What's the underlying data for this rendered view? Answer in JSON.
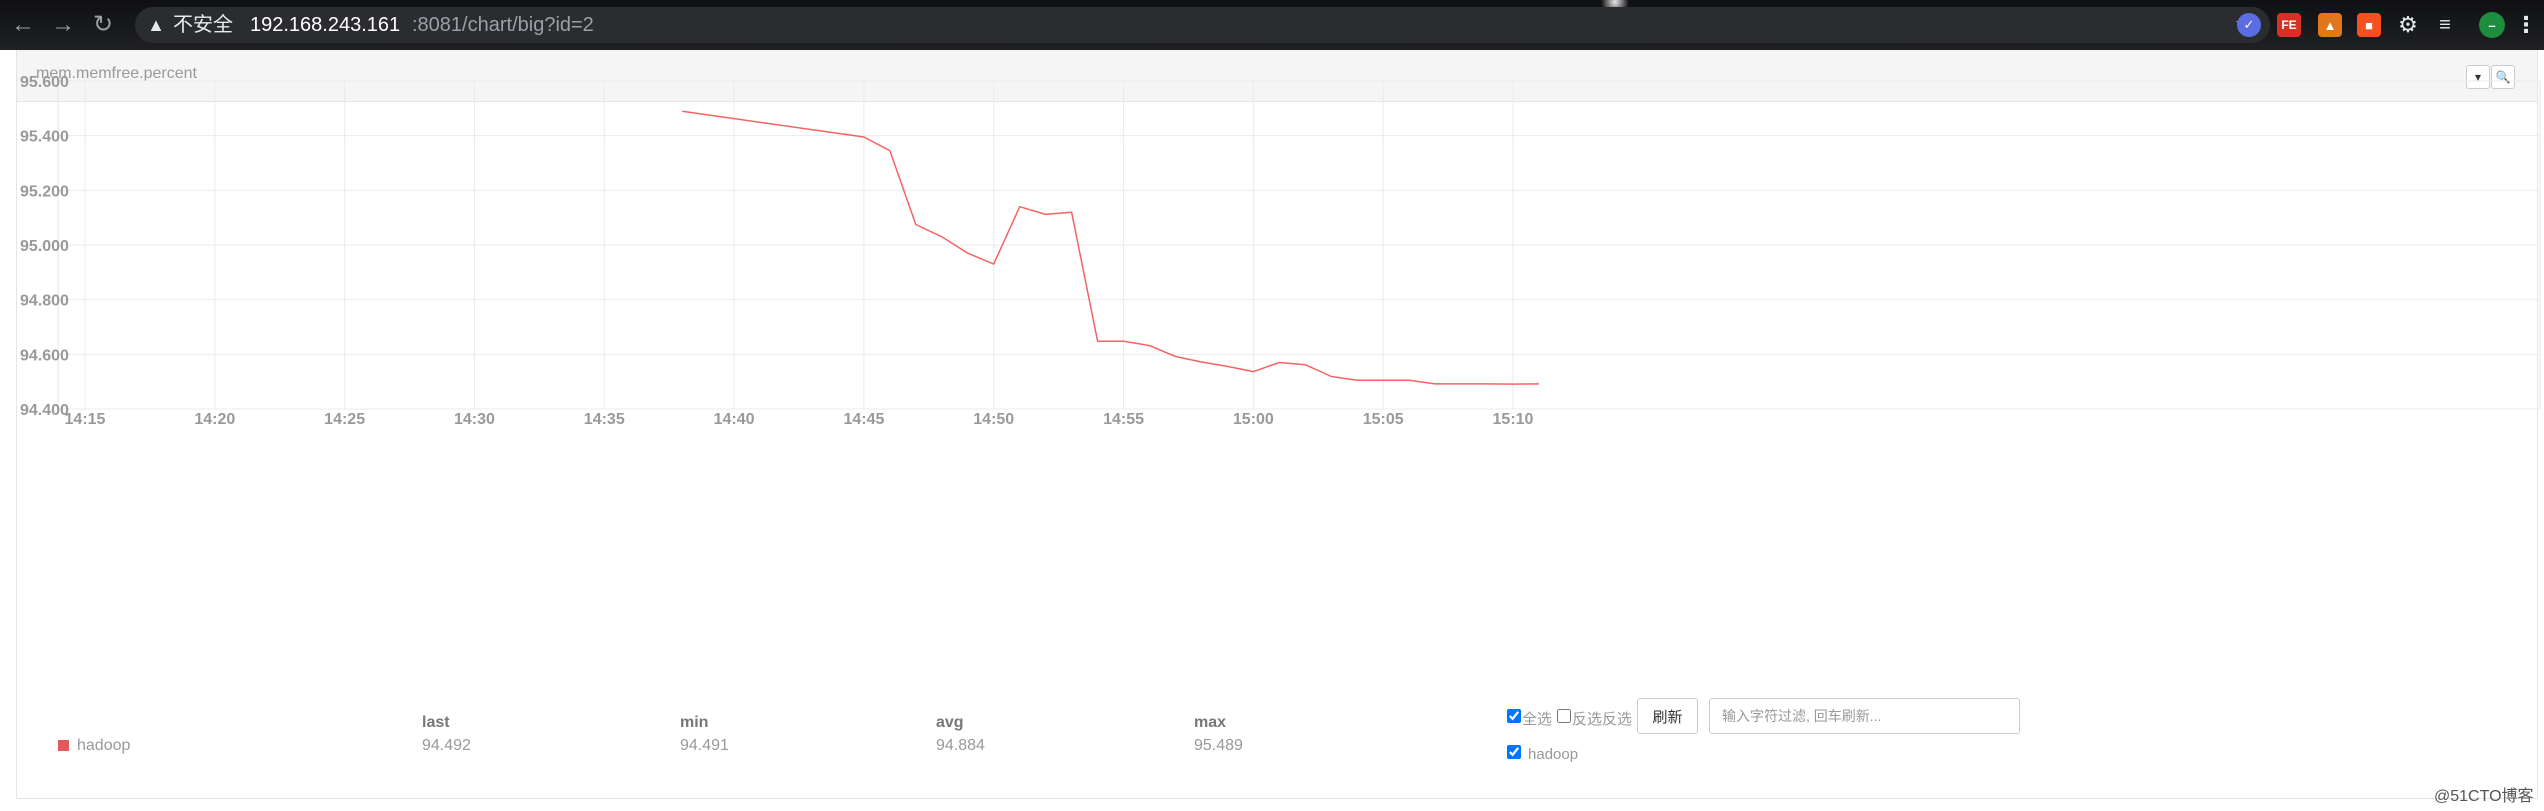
{
  "browser": {
    "insecure_label": "不安全",
    "url_host": "192.168.243.161",
    "url_path": ":8081/chart/big?id=2",
    "icons": [
      "back-icon",
      "forward-icon",
      "reload-icon",
      "warning-icon",
      "bookmark-star-icon",
      "extension-check-icon",
      "extension-fe-icon",
      "metamask-fox-icon",
      "extension-gift-icon",
      "puzzle-icon",
      "reading-list-icon",
      "profile-avatar-icon",
      "kebab-menu-icon"
    ],
    "ext_fe_label": "FE",
    "avatar_label": "–"
  },
  "panel": {
    "title": "mem.memfree.percent",
    "dropdown_label": "▾",
    "zoom_label": "🔍"
  },
  "chart_data": {
    "type": "line",
    "title": "",
    "xlabel": "",
    "ylabel": "",
    "x_ticks": [
      "14:15",
      "14:20",
      "14:25",
      "14:30",
      "14:35",
      "14:40",
      "14:45",
      "14:50",
      "14:55",
      "15:00",
      "15:05",
      "15:10"
    ],
    "y_ticks": [
      "95.600",
      "95.400",
      "95.200",
      "95.000",
      "94.800",
      "94.600",
      "94.400"
    ],
    "ylim": [
      94.4,
      95.6
    ],
    "grid": true,
    "series": [
      {
        "name": "hadoop",
        "color": "#f26464",
        "x": [
          "14:38",
          "14:45",
          "14:46",
          "14:47",
          "14:48",
          "14:49",
          "14:50",
          "14:51",
          "14:52",
          "14:53",
          "14:54",
          "14:55",
          "14:56",
          "14:57",
          "14:58",
          "14:59",
          "15:00",
          "15:01",
          "15:02",
          "15:03",
          "15:04",
          "15:05",
          "15:06",
          "15:07",
          "15:08",
          "15:09",
          "15:10",
          "15:11"
        ],
        "values": [
          95.489,
          95.395,
          95.345,
          95.075,
          95.03,
          94.97,
          94.93,
          95.14,
          95.112,
          95.12,
          94.648,
          94.648,
          94.632,
          94.592,
          94.572,
          94.556,
          94.537,
          94.57,
          94.562,
          94.519,
          94.505,
          94.505,
          94.505,
          94.492,
          94.492,
          94.492,
          94.491,
          94.492
        ]
      }
    ]
  },
  "legend": {
    "series_name": "hadoop",
    "headers": {
      "last": "last",
      "min": "min",
      "avg": "avg",
      "max": "max"
    },
    "values": {
      "last": "94.492",
      "min": "94.491",
      "avg": "94.884",
      "max": "95.489"
    }
  },
  "controls": {
    "select_all": "全选",
    "invert": "反选",
    "invert_selection": "反选",
    "refresh_label": "刷新",
    "filter_placeholder": "输入字符过滤, 回车刷新...",
    "host_label": "hadoop"
  },
  "watermark": "@51CTO博客"
}
